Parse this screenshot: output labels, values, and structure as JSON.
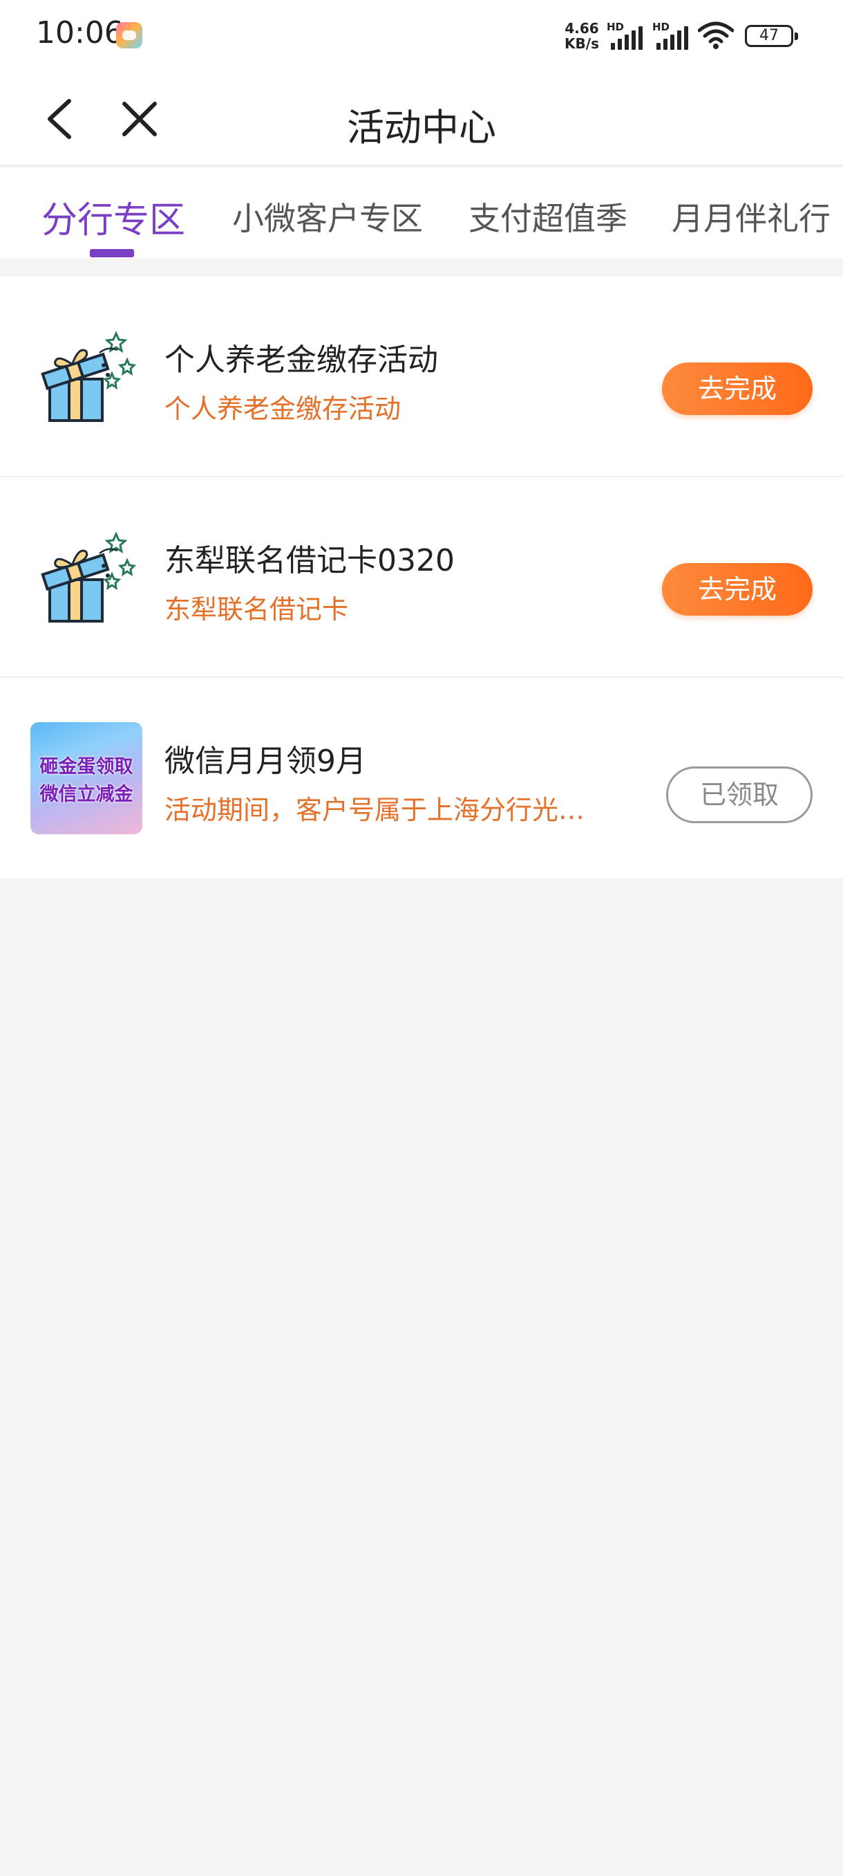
{
  "status_bar": {
    "time": "10:06",
    "net_speed_value": "4.66",
    "net_speed_unit": "KB/s",
    "sim1_label": "HD",
    "sim2_label": "HD",
    "battery": "47"
  },
  "header": {
    "title": "活动中心"
  },
  "tabs": [
    {
      "label": "分行专区",
      "active": true
    },
    {
      "label": "小微客户专区",
      "active": false
    },
    {
      "label": "支付超值季",
      "active": false
    },
    {
      "label": "月月伴礼行",
      "active": false
    }
  ],
  "activities": [
    {
      "title": "个人养老金缴存活动",
      "subtitle": "个人养老金缴存活动",
      "button": "去完成",
      "icon": "gift-box-icon"
    },
    {
      "title": "东犁联名借记卡0320",
      "subtitle": "东犁联名借记卡",
      "button": "去完成",
      "icon": "gift-box-icon"
    },
    {
      "title": "微信月月领9月",
      "subtitle": "活动期间，客户号属于上海分行光…",
      "button": "已领取",
      "banner_line1": "砸金蛋领取",
      "banner_line2": "微信立减金"
    }
  ],
  "colors": {
    "accent_purple": "#7a3fc4",
    "orange": "#ff6a1a",
    "subtitle_orange": "#e5702a"
  }
}
